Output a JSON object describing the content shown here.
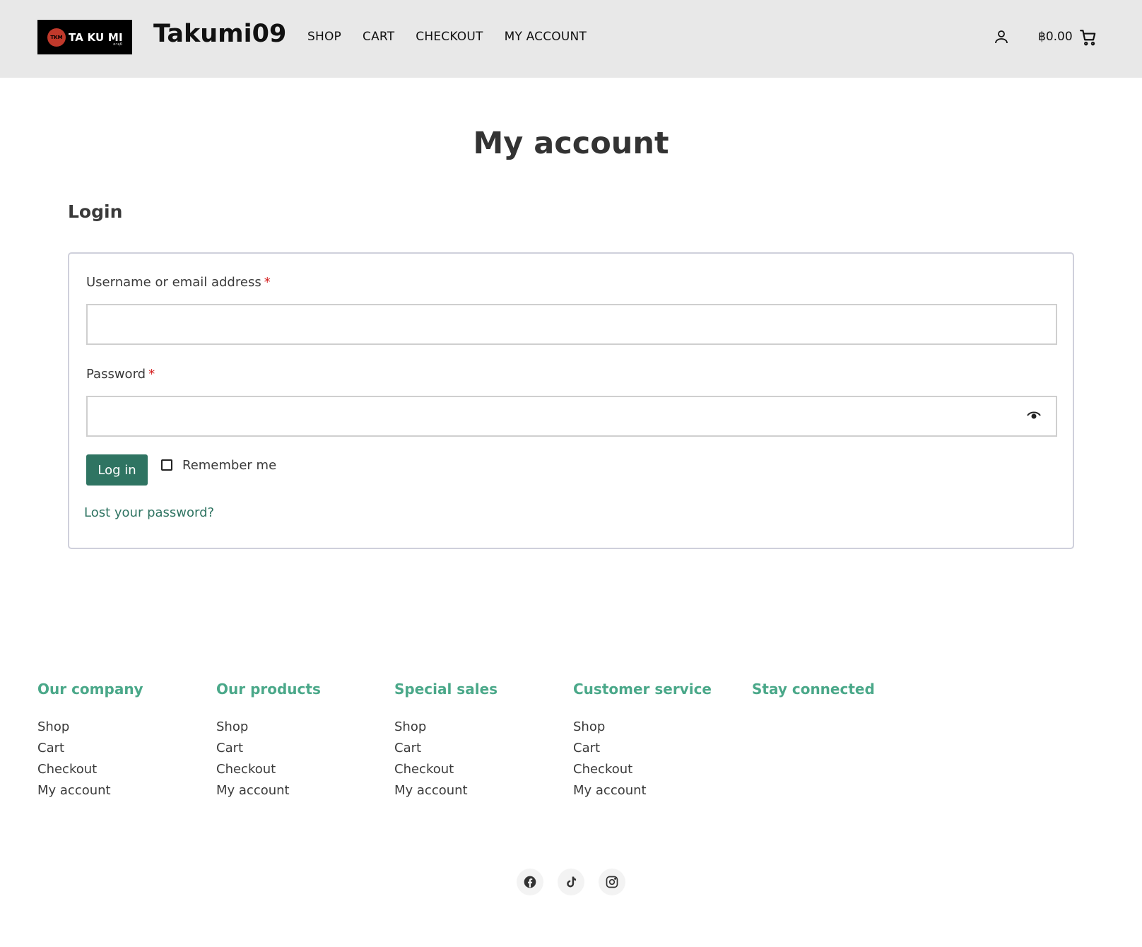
{
  "header": {
    "logo": {
      "badge": "TKM",
      "text": "TA KU MI",
      "sub": "ตาคุมิ"
    },
    "site_title": "Takumi09",
    "nav": [
      "SHOP",
      "CART",
      "CHECKOUT",
      "MY ACCOUNT"
    ],
    "account_icon": "user-icon",
    "cart_total": "฿0.00",
    "cart_icon": "shopping-cart-icon"
  },
  "main": {
    "page_title": "My account",
    "login_heading": "Login",
    "username_label": "Username or email address",
    "password_label": "Password",
    "required_marker": "*",
    "username_value": "",
    "password_value": "",
    "password_toggle_icon": "eye-icon",
    "login_button": "Log in",
    "remember_label": "Remember me",
    "remember_checked": false,
    "lost_password": "Lost your password?"
  },
  "footer": {
    "columns": [
      {
        "heading": "Our company",
        "links": [
          "Shop",
          "Cart",
          "Checkout",
          "My account"
        ]
      },
      {
        "heading": "Our products",
        "links": [
          "Shop",
          "Cart",
          "Checkout",
          "My account"
        ]
      },
      {
        "heading": "Special sales",
        "links": [
          "Shop",
          "Cart",
          "Checkout",
          "My account"
        ]
      },
      {
        "heading": "Customer service",
        "links": [
          "Shop",
          "Cart",
          "Checkout",
          "My account"
        ]
      },
      {
        "heading": "Stay connected",
        "links": []
      }
    ],
    "social": [
      "facebook-icon",
      "tiktok-icon",
      "instagram-icon"
    ]
  },
  "colors": {
    "header_bg": "#e8e8e8",
    "accent": "#2f7462",
    "footer_heading": "#4aa889",
    "required": "#d41c1c"
  }
}
